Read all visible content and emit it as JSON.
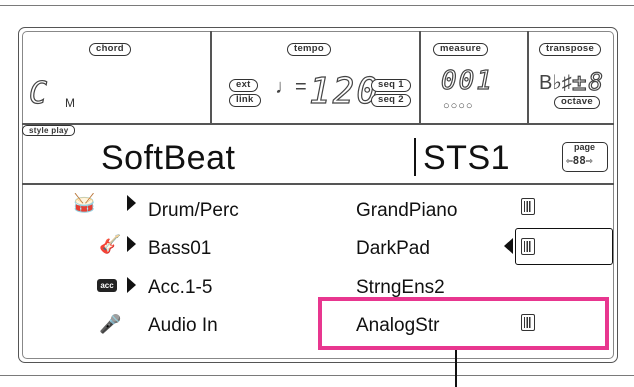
{
  "top_bar": {
    "chord": {
      "label": "chord",
      "value": "C",
      "suffix": "M"
    },
    "tempo": {
      "label": "tempo",
      "ext": "ext",
      "link": "link",
      "value": "120",
      "seq1": "seq 1",
      "seq2": "seq 2",
      "note_symbol": "♩="
    },
    "measure": {
      "label": "measure",
      "value": "001",
      "beats": "○○○○"
    },
    "transpose": {
      "label": "transpose",
      "accidentals": "B♭♯",
      "value": "±8",
      "octave": "octave"
    }
  },
  "style_play": {
    "label": "style play",
    "style_name": "SoftBeat",
    "sts_name": "STS1",
    "page": {
      "label": "page",
      "value": "⇦88⇨"
    }
  },
  "tracks_left": [
    {
      "icon": "drum-perc-icon",
      "glyph": "🥁",
      "label": "Drum/Perc",
      "arrow": true
    },
    {
      "icon": "bass-guitar-icon",
      "glyph": "🎸",
      "label": "Bass01",
      "arrow": true
    },
    {
      "icon": "acc-icon",
      "glyph": "acc",
      "label": "Acc.1-5",
      "arrow": true
    },
    {
      "icon": "audio-in-icon",
      "glyph": "🎤",
      "label": "Audio In",
      "arrow": false
    }
  ],
  "tracks_right": [
    {
      "label": "GrandPiano",
      "keyboard": true,
      "selected": false
    },
    {
      "label": "DarkPad",
      "keyboard": true,
      "selected": true
    },
    {
      "label": "StrngEns2",
      "keyboard": false,
      "selected": false
    },
    {
      "label": "AnalogStr",
      "keyboard": true,
      "selected": false
    }
  ],
  "colors": {
    "highlight": "#e8368f",
    "ink": "#111111",
    "frame": "#555555"
  }
}
